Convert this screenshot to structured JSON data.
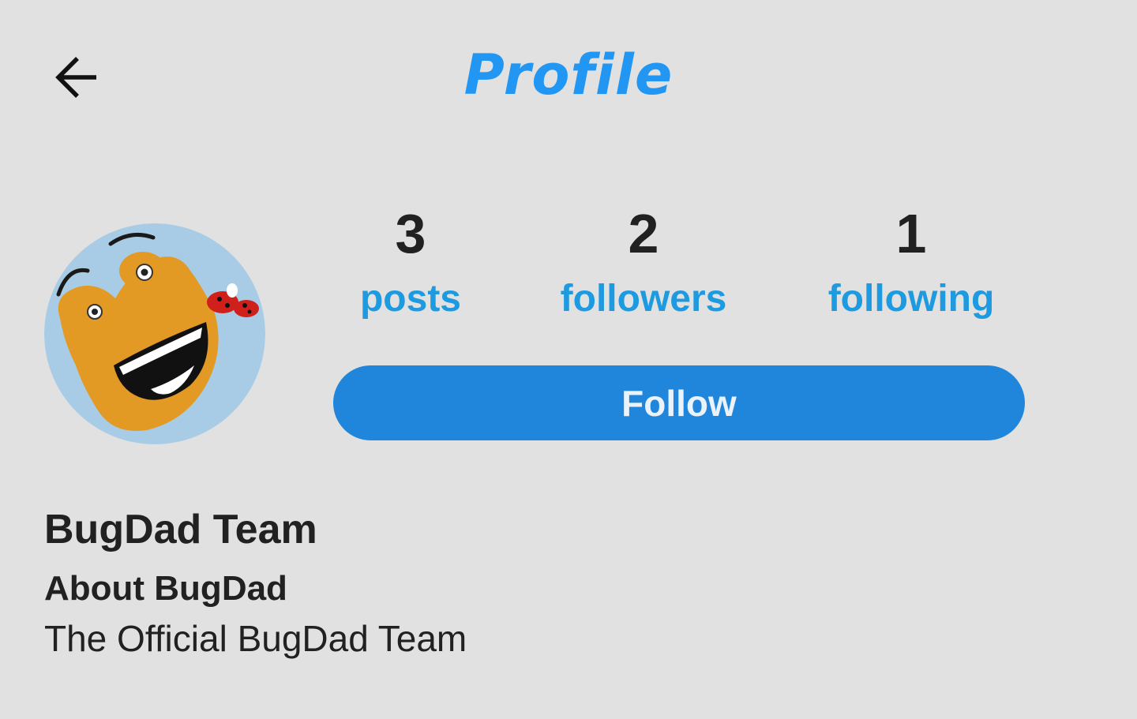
{
  "app": {
    "title": "Profile",
    "back_icon": "arrow-left-icon",
    "colors": {
      "background": "#e1e1e1",
      "title": "#2196f3",
      "stat_label": "#1e9be0",
      "follow_button": "#2086dc",
      "text": "#212121"
    }
  },
  "stats": [
    {
      "value": "3",
      "label": "posts"
    },
    {
      "value": "2",
      "label": "followers"
    },
    {
      "value": "1",
      "label": "following"
    }
  ],
  "follow_button": {
    "label": "Follow"
  },
  "profile": {
    "name": "BugDad Team",
    "about_title": "About BugDad",
    "about_text": "The Official BugDad Team",
    "avatar_icon": "bugdad-avatar"
  }
}
